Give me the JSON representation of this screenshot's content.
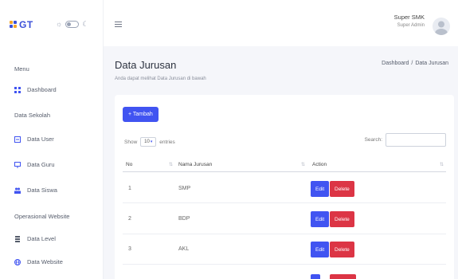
{
  "brand": {
    "text": "GT"
  },
  "sidebar": {
    "sections": [
      {
        "heading": "Menu"
      },
      {
        "heading": "Data Sekolah"
      },
      {
        "heading": "Operasional Website"
      }
    ],
    "items": [
      {
        "label": "Dashboard",
        "icon": "grid-icon"
      },
      {
        "label": "Data User",
        "icon": "user-card-icon"
      },
      {
        "label": "Data Guru",
        "icon": "teacher-icon"
      },
      {
        "label": "Data Siswa",
        "icon": "students-icon"
      },
      {
        "label": "Data Level",
        "icon": "layers-icon"
      },
      {
        "label": "Data Website",
        "icon": "globe-icon"
      }
    ]
  },
  "topbar": {
    "user_name": "Super SMK",
    "user_role": "Super Admin"
  },
  "page": {
    "title": "Data Jurusan",
    "subtitle": "Anda dapat melihat Data Jurusan di bawah",
    "breadcrumb": [
      "Dashboard",
      "/",
      "Data Jurusan"
    ]
  },
  "table": {
    "add_label": "+ Tambah",
    "show_label": "Show",
    "entries_value": "10",
    "entries_label": "entries",
    "search_label": "Search:",
    "columns": [
      "No",
      "Nama Jurusan",
      "Action"
    ],
    "rows": [
      {
        "no": "1",
        "name": "SMP"
      },
      {
        "no": "2",
        "name": "BDP"
      },
      {
        "no": "3",
        "name": "AKL"
      }
    ],
    "edit_label": "Edit",
    "delete_label": "Delete"
  },
  "colors": {
    "primary": "#4154f1",
    "danger": "#dc3545",
    "background": "#f5f6fa"
  }
}
